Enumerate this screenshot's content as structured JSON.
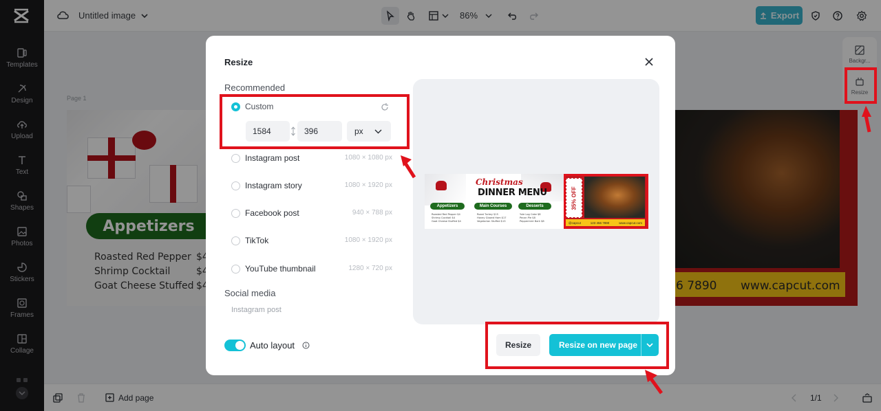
{
  "app": {
    "title": "Untitled image",
    "zoom": "86%",
    "export_label": "Export"
  },
  "sidebar": {
    "items": [
      {
        "label": "Templates",
        "icon": "templates-icon"
      },
      {
        "label": "Design",
        "icon": "design-icon"
      },
      {
        "label": "Upload",
        "icon": "upload-icon"
      },
      {
        "label": "Text",
        "icon": "text-icon"
      },
      {
        "label": "Shapes",
        "icon": "shapes-icon"
      },
      {
        "label": "Photos",
        "icon": "photos-icon"
      },
      {
        "label": "Stickers",
        "icon": "stickers-icon"
      },
      {
        "label": "Frames",
        "icon": "frames-icon"
      },
      {
        "label": "Collage",
        "icon": "collage-icon"
      }
    ]
  },
  "right_panel": {
    "items": [
      {
        "label": "Backgr...",
        "icon": "background-icon"
      },
      {
        "label": "Resize",
        "icon": "resize-icon"
      }
    ]
  },
  "canvas": {
    "page_label": "Page 1",
    "left": {
      "band_title": "Appetizers",
      "items": [
        "Roasted Red Pepper",
        "Shrimp Cocktail",
        "Goat Cheese Stuffed"
      ],
      "price_prefix": "$4"
    },
    "right": {
      "phone_fragment": "6 7890",
      "website": "www.capcut.com"
    }
  },
  "modal": {
    "title": "Resize",
    "recommended_label": "Recommended",
    "custom_label": "Custom",
    "width_value": "1584",
    "height_value": "396",
    "unit": "px",
    "options": [
      {
        "label": "Instagram post",
        "size": "1080 × 1080 px"
      },
      {
        "label": "Instagram story",
        "size": "1080 × 1920 px"
      },
      {
        "label": "Facebook post",
        "size": "940 × 788 px"
      },
      {
        "label": "TikTok",
        "size": "1080 × 1920 px"
      },
      {
        "label": "YouTube thumbnail",
        "size": "1280 × 720 px"
      }
    ],
    "social_label": "Social media",
    "social_sub": "Instagram post",
    "auto_layout_label": "Auto layout",
    "auto_layout_on": true,
    "resize_label": "Resize",
    "resize_new_label": "Resize on new page",
    "preview": {
      "title_script": "Christmas",
      "title_main": "DINNER MENU",
      "pills": [
        "Appetizers",
        "Main Courses",
        "Desserts"
      ],
      "discount": "35% OFF",
      "phone": "123 456 7890",
      "handle": "@capcut",
      "site": "www.capcut.com"
    }
  },
  "bottom": {
    "add_page_label": "Add page",
    "page_count": "1/1"
  },
  "colors": {
    "accent": "#14c1d6",
    "highlight": "#e0121c",
    "sidebar_bg": "#1a1a1d"
  }
}
